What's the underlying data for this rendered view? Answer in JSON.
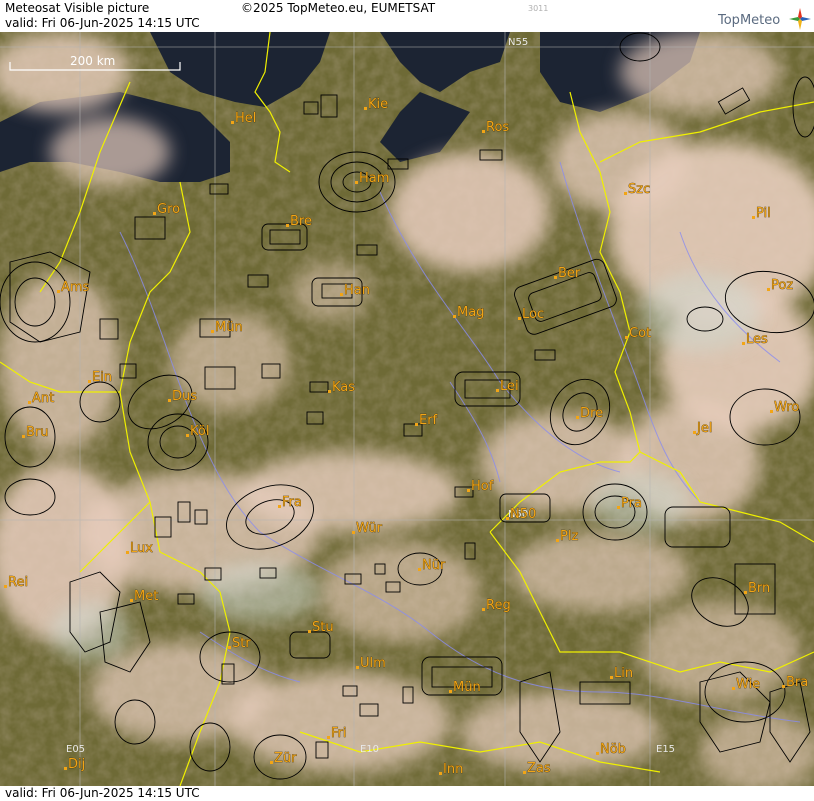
{
  "header": {
    "title": "Meteosat Visible picture",
    "copyright": "©2025 TopMeteo.eu, EUMETSAT",
    "code": "3011",
    "valid": "valid:  Fri  06-Jun-2025  14:15 UTC",
    "logo": "TopMeteo"
  },
  "footer": {
    "valid": "valid:  Fri  06-Jun-2025  14:15 UTC"
  },
  "scale_bar": {
    "label": "200 km"
  },
  "grid_labels": [
    "N55",
    "N50",
    "E05",
    "E10",
    "E15"
  ],
  "cities": [
    "Hel",
    "Kie",
    "Ros",
    "Ham",
    "Szc",
    "Gro",
    "Bre",
    "Pil",
    "Ams",
    "Ber",
    "Han",
    "Poz",
    "Mün",
    "Mag",
    "Loc",
    "Cot",
    "Les",
    "Ein",
    "Lei",
    "Kas",
    "Dus",
    "Ant",
    "Wro",
    "Dre",
    "Köl",
    "Bru",
    "Erf",
    "Jel",
    "Hof",
    "Pra",
    "Fra",
    "N50",
    "Wür",
    "Plz",
    "Lux",
    "Nür",
    "Rei",
    "Brn",
    "Met",
    "Reg",
    "Stu",
    "Str",
    "Lin",
    "Ulm",
    "Mün",
    "Wie",
    "Bra",
    "Fri",
    "Dij",
    "Zür",
    "Inn",
    "Zas",
    "Nöb"
  ],
  "colors": {
    "city": "#f2a516",
    "border": "#f0f000",
    "rivers": "#8a8cf0",
    "airspace": "#000000",
    "grid": "#b4b4b4"
  }
}
